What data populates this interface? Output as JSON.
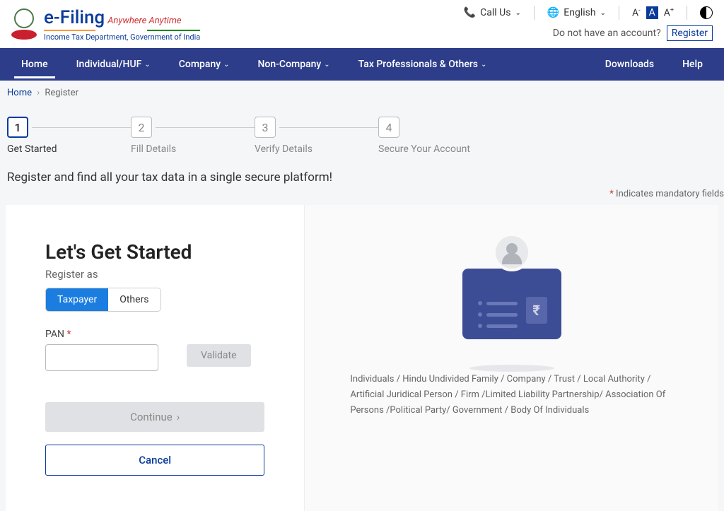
{
  "header": {
    "logo": {
      "title": "e-Filing",
      "tagline": "Anywhere Anytime",
      "subtitle": "Income Tax Department, Government of India"
    },
    "call_us": "Call Us",
    "language": "English",
    "font_small": "A⁻",
    "font_medium": "A",
    "font_large": "A⁺",
    "no_account": "Do not have an account?",
    "register": "Register"
  },
  "nav": {
    "home": "Home",
    "individual": "Individual/HUF",
    "company": "Company",
    "noncompany": "Non-Company",
    "tax_pros": "Tax Professionals & Others",
    "downloads": "Downloads",
    "help": "Help"
  },
  "breadcrumb": {
    "home": "Home",
    "current": "Register"
  },
  "steps": [
    {
      "num": "1",
      "label": "Get Started"
    },
    {
      "num": "2",
      "label": "Fill Details"
    },
    {
      "num": "3",
      "label": "Verify Details"
    },
    {
      "num": "4",
      "label": "Secure Your Account"
    }
  ],
  "page_heading": "Register and find all your tax data in a single secure platform!",
  "mandatory": "Indicates mandatory fields",
  "form": {
    "title": "Let's Get Started",
    "register_as": "Register as",
    "taxpayer": "Taxpayer",
    "others": "Others",
    "pan_label": "PAN",
    "validate": "Validate",
    "continue": "Continue",
    "cancel": "Cancel"
  },
  "right_text": "Individuals / Hindu Undivided Family / Company / Trust / Local Authority / Artificial Juridical Person / Firm /Limited Liability Partnership/ Association Of Persons /Political Party/ Government / Body Of Individuals"
}
